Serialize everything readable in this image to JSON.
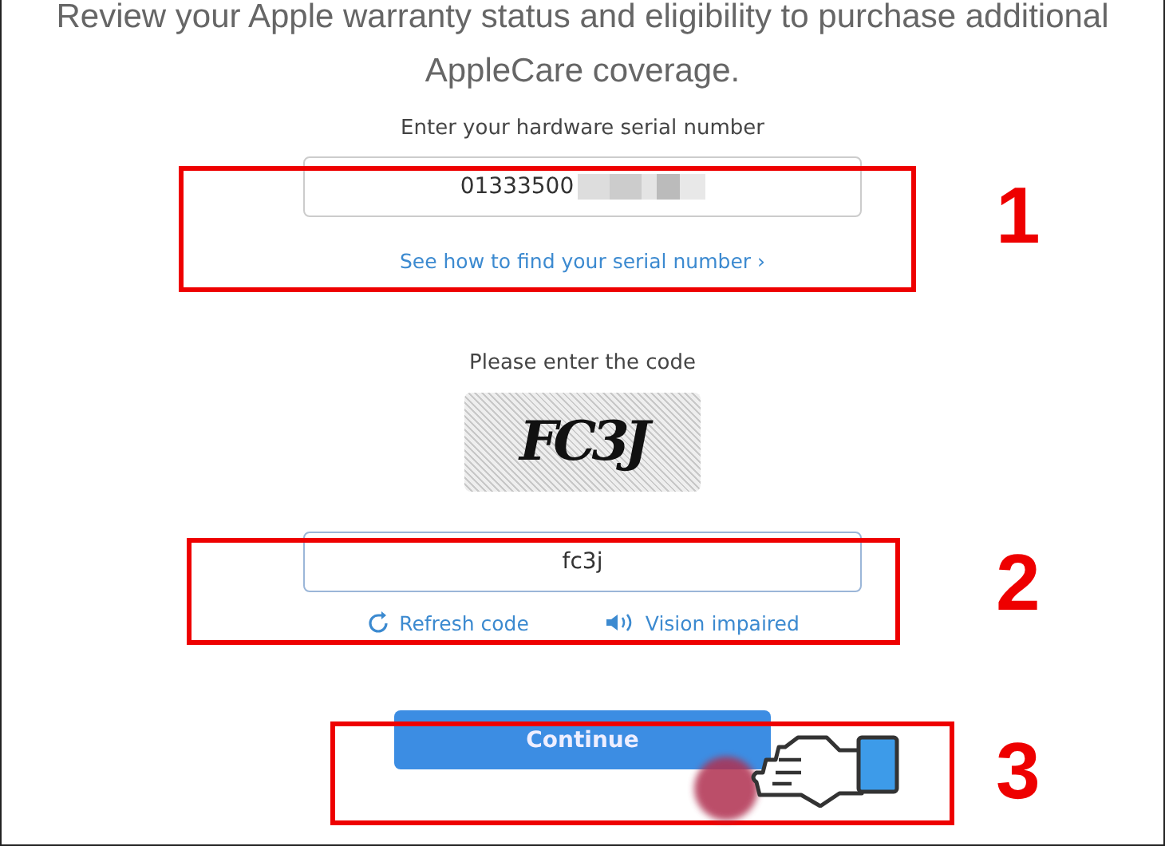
{
  "intro": "Review your Apple warranty status and eligibility to purchase additional AppleCare coverage.",
  "serial": {
    "label": "Enter your hardware serial number",
    "value": "01333500",
    "redacted": true
  },
  "help_link": "See how to find your serial number ›",
  "code": {
    "label": "Please enter the code",
    "captcha": "FC3J",
    "value": "fc3j"
  },
  "code_links": [
    {
      "kind": "refresh",
      "label": "Refresh code"
    },
    {
      "kind": "audio",
      "label": "Vision impaired"
    }
  ],
  "continue_button": "Continue",
  "annotations": [
    {
      "number": "1"
    },
    {
      "number": "2"
    },
    {
      "number": "3"
    }
  ]
}
